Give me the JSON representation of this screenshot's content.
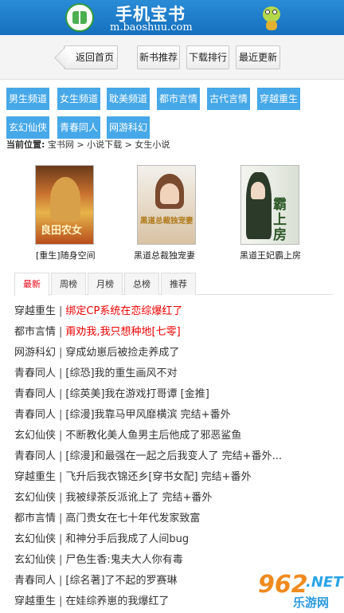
{
  "header": {
    "site_name": "手机宝书",
    "site_url": "m.baoshuu.com"
  },
  "nav": {
    "back": "返回首页",
    "buttons": [
      "新书推荐",
      "下载排行",
      "最近更新"
    ]
  },
  "categories": [
    "男生频道",
    "女生频道",
    "耽美频道",
    "都市言情",
    "古代言情",
    "穿越重生",
    "玄幻仙侠",
    "青春同人",
    "网游科幻"
  ],
  "breadcrumb": {
    "label": "当前位置:",
    "path": "宝书网 > 小说下载 > 女生小说"
  },
  "featured": [
    {
      "title": "[重生]随身空间",
      "cover_text": "良田农女"
    },
    {
      "title": "黑道总裁独宠妻",
      "cover_text": "黑道总裁独宠妻"
    },
    {
      "title": "黑道王妃霸上房",
      "cover_text": "霸上房"
    }
  ],
  "tabs": [
    "最新",
    "周榜",
    "月榜",
    "总榜",
    "推荐"
  ],
  "active_tab": 0,
  "list": [
    {
      "category": "穿越重生",
      "title": "绑定CP系统在恋综爆红了",
      "highlight": true
    },
    {
      "category": "都市言情",
      "title": "甭劝我,我只想种地[七零]",
      "highlight": true
    },
    {
      "category": "网游科幻",
      "title": "穿成幼崽后被捡走养成了",
      "highlight": false
    },
    {
      "category": "青春同人",
      "title": "[综恐]我的重生画风不对",
      "highlight": false
    },
    {
      "category": "青春同人",
      "title": "[综英美]我在游戏打哥谭 [金推]",
      "highlight": false
    },
    {
      "category": "青春同人",
      "title": "[综漫]我靠马甲风靡横滨 完结+番外",
      "highlight": false
    },
    {
      "category": "玄幻仙侠",
      "title": "不断教化美人鱼男主后他成了邪恶鲨鱼",
      "highlight": false
    },
    {
      "category": "青春同人",
      "title": "[综漫]和最强在一起之后我变人了 完结+番外...",
      "highlight": false
    },
    {
      "category": "穿越重生",
      "title": "飞升后我衣锦还乡[穿书女配] 完结+番外",
      "highlight": false
    },
    {
      "category": "玄幻仙侠",
      "title": "我被绿茶反派讹上了 完结+番外",
      "highlight": false
    },
    {
      "category": "都市言情",
      "title": "高门贵女在七十年代发家致富",
      "highlight": false
    },
    {
      "category": "玄幻仙侠",
      "title": "和神分手后我成了人间bug",
      "highlight": false
    },
    {
      "category": "玄幻仙侠",
      "title": "尸色生香:鬼夫大人你有毒",
      "highlight": false
    },
    {
      "category": "青春同人",
      "title": "[综名著]了不起的罗赛琳",
      "highlight": false
    },
    {
      "category": "穿越重生",
      "title": "在娃综养崽的我爆红了",
      "highlight": false
    }
  ],
  "separator": "|",
  "watermark": {
    "num": "962",
    "net": ".NET",
    "site": "乐游网"
  },
  "colors": {
    "header_blue": "#1a7bc9",
    "category_blue": "#46a8e8",
    "highlight_red": "#e00000",
    "active_tab_red": "#e60012"
  }
}
